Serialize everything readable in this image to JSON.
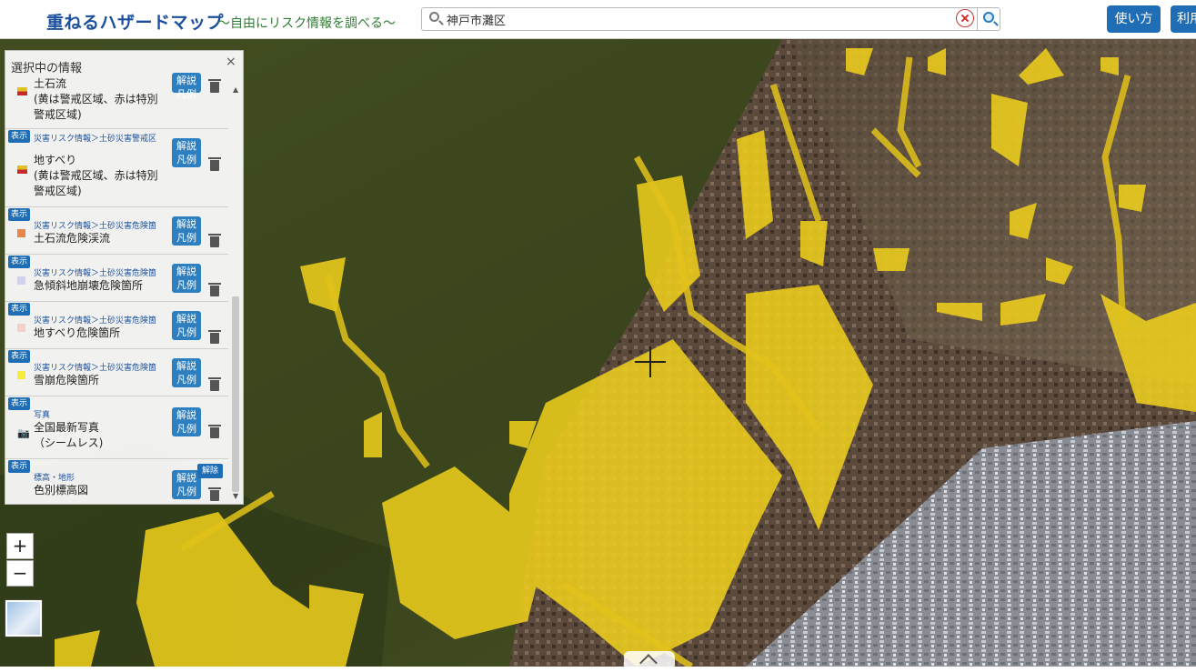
{
  "header": {
    "title": "重ねるハザードマップ",
    "subtitle": "～自由にリスク情報を調べる～",
    "search_value": "神戸市灘区",
    "usage_button": "使い方",
    "terms_button": "利用"
  },
  "panel": {
    "title": "選択中の情報",
    "close": "×",
    "items": [
      {
        "badge": "",
        "category": "",
        "name": "土石流\n(黄は警戒区域、赤は特別\n警戒区域)",
        "legend": "解説\n凡例",
        "swatch": "#e0c020"
      },
      {
        "badge": "表示",
        "category": "災害リスク情報＞土砂災害警戒区",
        "name": "地すべり\n(黄は警戒区域、赤は特別\n警戒区域)",
        "legend": "解説\n凡例",
        "swatch": "#e0c020"
      },
      {
        "badge": "表示",
        "category": "災害リスク情報＞土砂災害危険箇",
        "name": "土石流危険渓流",
        "legend": "解説\n凡例",
        "swatch": "#e8864a"
      },
      {
        "badge": "表示",
        "category": "災害リスク情報＞土砂災害危険箇",
        "name": "急傾斜地崩壊危険箇所",
        "legend": "解説\n凡例",
        "swatch": "#cfd3ee"
      },
      {
        "badge": "表示",
        "category": "災害リスク情報＞土砂災害危険箇",
        "name": "地すべり危険箇所",
        "legend": "解説\n凡例",
        "swatch": "#f5d0c8"
      },
      {
        "badge": "表示",
        "category": "災害リスク情報＞土砂災害危険箇",
        "name": "雪崩危険箇所",
        "legend": "解説\n凡例",
        "swatch": "#f3ec3a"
      },
      {
        "badge": "表示",
        "category": "写真",
        "name": "全国最新写真\n（シームレス)",
        "legend": "解説\n凡例",
        "swatch": ""
      },
      {
        "badge": "表示",
        "category": "標高・地形",
        "name": "色別標高図",
        "legend": "解説\n凡例",
        "swatch": "",
        "extra": "解除"
      }
    ]
  },
  "map": {
    "zoom_in": "+",
    "zoom_out": "−",
    "hazard_color": "#f2d21c"
  }
}
